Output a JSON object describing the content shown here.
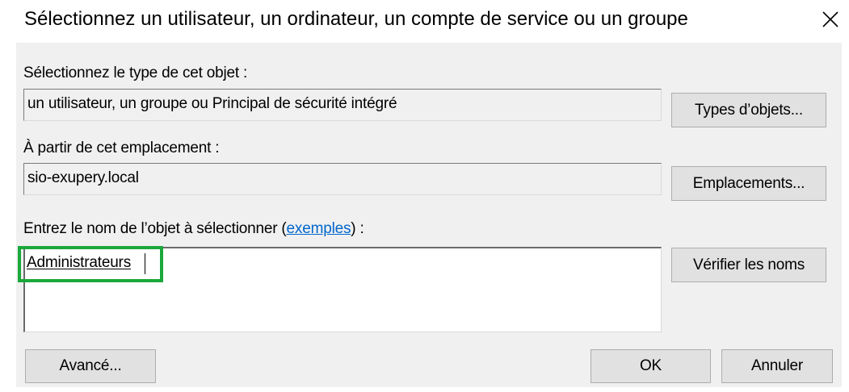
{
  "dialog": {
    "title": "Sélectionnez un utilisateur, un ordinateur, un compte de service ou un groupe",
    "close_icon": "close-icon"
  },
  "object_type": {
    "label": "Sélectionnez le type de cet objet :",
    "value": "un utilisateur, un groupe ou Principal de sécurité intégré",
    "button": "Types d’objets..."
  },
  "location": {
    "label": "À partir de cet emplacement :",
    "value": "sio-exupery.local",
    "button": "Emplacements..."
  },
  "names": {
    "label_prefix": "Entrez le nom de l’objet à sélectionner (",
    "label_link": "exemples",
    "label_suffix": ") :",
    "value": "Administrateurs",
    "check_button": "Vérifier les noms"
  },
  "footer": {
    "advanced_button": "Avancé...",
    "ok_button": "OK",
    "cancel_button": "Annuler"
  },
  "colors": {
    "highlight": "#1aa83a",
    "link": "#0066cc",
    "panel": "#f0f0f0",
    "button": "#e1e1e1"
  }
}
